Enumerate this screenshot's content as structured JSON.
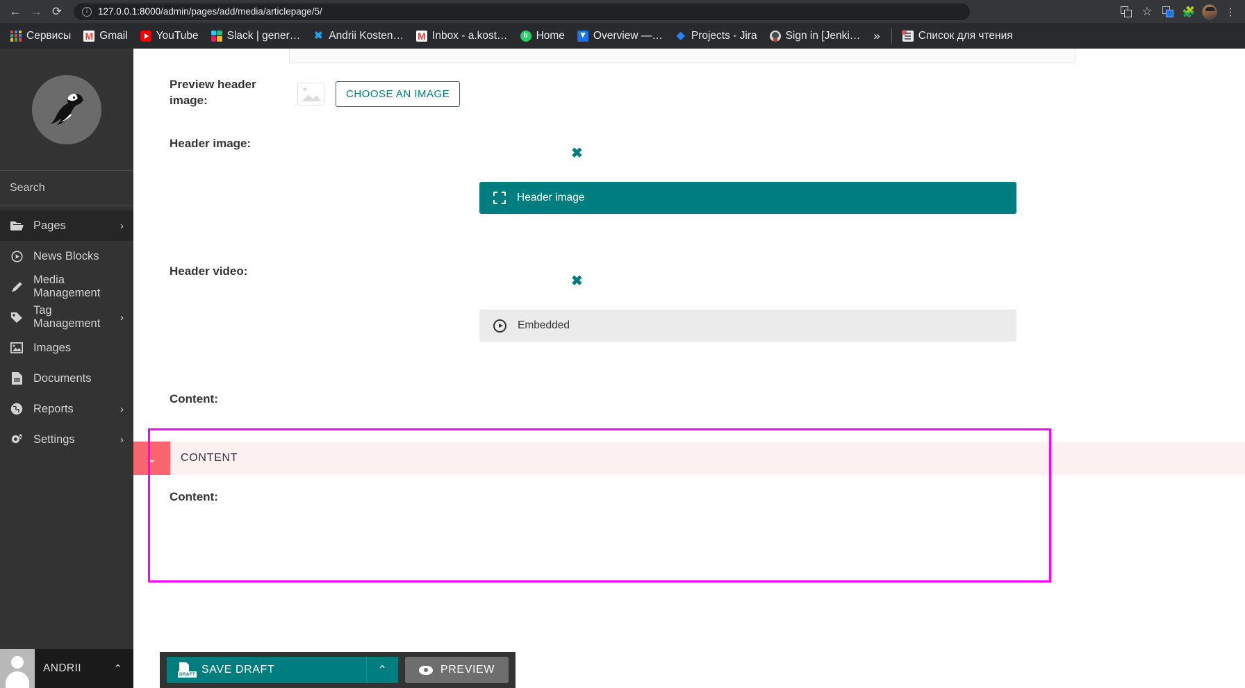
{
  "browser": {
    "back_icon": "back-arrow-icon",
    "forward_icon": "forward-arrow-icon",
    "reload_icon": "reload-icon",
    "url_host": "127.0.0.1:8000",
    "url_path": "/admin/pages/add/media/articlepage/5/",
    "site_info_icon": "site-info-icon",
    "toolbar_icons": [
      "translate-icon",
      "bookmark-star-icon",
      "google-translate-extension-icon",
      "extensions-puzzle-icon",
      "profile-avatar-icon",
      "chrome-menu-kebab-icon"
    ],
    "bookmarks": [
      {
        "label": "Сервисы",
        "icon": "google-apps-icon"
      },
      {
        "label": "Gmail",
        "icon": "gmail-icon"
      },
      {
        "label": "YouTube",
        "icon": "youtube-icon"
      },
      {
        "label": "Slack | gener…",
        "icon": "slack-icon"
      },
      {
        "label": "Andrii Kosten…",
        "icon": "twitter-icon"
      },
      {
        "label": "Inbox - a.kost…",
        "icon": "gmail-icon"
      },
      {
        "label": "Home",
        "icon": "home-green-icon"
      },
      {
        "label": "Overview —…",
        "icon": "confluence-icon"
      },
      {
        "label": "Projects - Jira",
        "icon": "jira-icon"
      },
      {
        "label": "Sign in [Jenki…",
        "icon": "jenkins-icon"
      }
    ],
    "overflow_label": "»",
    "reading_list_label": "Список для чтения",
    "reading_list_icon": "reading-list-icon"
  },
  "sidebar": {
    "logo_icon": "wagtail-bird-logo",
    "search": {
      "placeholder": "Search",
      "icon": "search-icon"
    },
    "items": [
      {
        "label": "Pages",
        "icon": "folder-open-icon",
        "has_chevron": true,
        "active": true
      },
      {
        "label": "News Blocks",
        "icon": "play-circle-icon",
        "has_chevron": false,
        "active": false
      },
      {
        "label": "Media Management",
        "icon": "pencil-icon",
        "has_chevron": false,
        "active": false
      },
      {
        "label": "Tag Management",
        "icon": "tag-icon",
        "has_chevron": true,
        "active": false
      },
      {
        "label": "Images",
        "icon": "image-icon",
        "has_chevron": false,
        "active": false
      },
      {
        "label": "Documents",
        "icon": "document-icon",
        "has_chevron": false,
        "active": false
      },
      {
        "label": "Reports",
        "icon": "globe-icon",
        "has_chevron": true,
        "active": false
      },
      {
        "label": "Settings",
        "icon": "gears-icon",
        "has_chevron": true,
        "active": false
      }
    ],
    "chevron_glyph": "›",
    "user": {
      "name": "ANDRII",
      "avatar_icon": "user-avatar-icon",
      "caret_glyph": "⌃"
    }
  },
  "form": {
    "preview_header_image": {
      "label": "Preview header image:",
      "placeholder_icon": "image-placeholder-icon",
      "choose_button": "CHOOSE AN IMAGE"
    },
    "header_image": {
      "label": "Header image:",
      "delete_glyph": "✖",
      "block_label": "Header image",
      "block_icon": "dashed-placeholder-icon"
    },
    "header_video": {
      "label": "Header video:",
      "delete_glyph": "✖",
      "block_label": "Embedded",
      "block_icon": "play-circle-icon"
    },
    "content_top_label": "Content:",
    "content_panel": {
      "title": "CONTENT",
      "toggle_icon": "chevron-down-icon",
      "toggle_glyph": "⌄"
    },
    "content_inner_label": "Content:"
  },
  "actions": {
    "save_draft": {
      "label": "SAVE DRAFT",
      "icon": "draft-document-icon",
      "caret_glyph": "⌃",
      "caret_icon": "chevron-up-icon"
    },
    "preview": {
      "label": "PREVIEW",
      "icon": "eye-icon"
    }
  },
  "colors": {
    "teal": "#007d7e",
    "magenta_highlight": "#ff00ff",
    "panel_red": "#f9656f",
    "panel_bg": "#fdf0f0",
    "sidebar_bg": "#333333",
    "grey_block": "#ebebeb",
    "preview_btn": "#6e6e6e"
  }
}
